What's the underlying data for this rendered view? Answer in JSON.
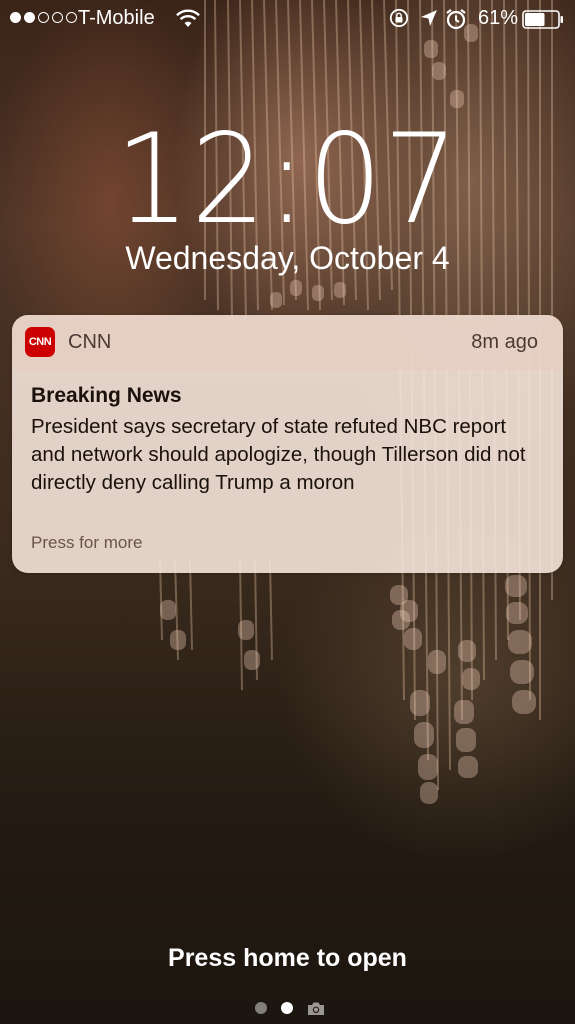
{
  "status_bar": {
    "signal_bars_filled": 2,
    "signal_bars_total": 5,
    "carrier": "T-Mobile",
    "wifi_icon": "wifi-icon",
    "rotation_lock_icon": "rotation-lock-icon",
    "location_icon": "location-arrow-icon",
    "alarm_icon": "alarm-clock-icon",
    "battery_percent": "61%",
    "battery_level": 0.61
  },
  "lock_screen": {
    "time": "12:07",
    "date": "Wednesday, October 4"
  },
  "notification": {
    "app_icon_text": "CNN",
    "app_icon_color": "#cc0000",
    "app_name": "CNN",
    "time_ago": "8m ago",
    "title": "Breaking News",
    "body": "President says secretary of state refuted NBC report and network should apologize, though Tillerson did not directly deny calling Trump a moron",
    "more_hint": "Press for more"
  },
  "bottom": {
    "unlock_hint": "Press home to open",
    "page_indicator": {
      "pages": 2,
      "active_index": 1,
      "camera_icon": "camera-icon"
    }
  }
}
